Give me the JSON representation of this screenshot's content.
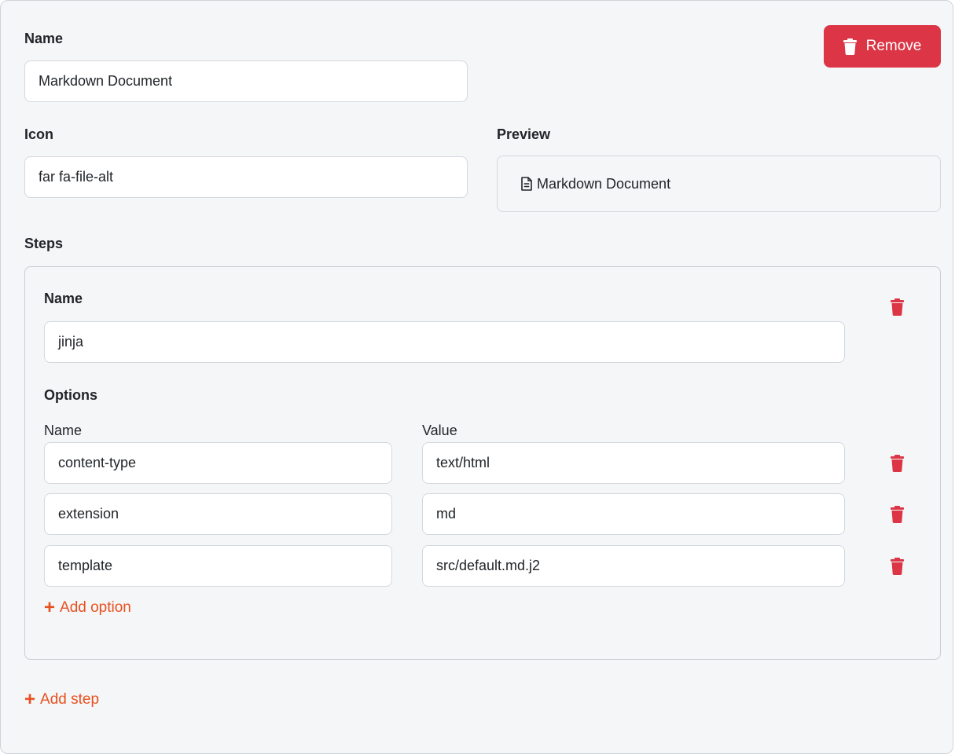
{
  "form": {
    "name_label": "Name",
    "name_value": "Markdown Document",
    "remove_label": "Remove",
    "icon_label": "Icon",
    "icon_value": "far fa-file-alt",
    "preview_label": "Preview",
    "preview_text": "Markdown Document",
    "steps_label": "Steps",
    "add_step_label": "Add step"
  },
  "step": {
    "name_label": "Name",
    "name_value": "jinja",
    "options_label": "Options",
    "col_name_label": "Name",
    "col_value_label": "Value",
    "options": [
      {
        "name": "content-type",
        "value": "text/html"
      },
      {
        "name": "extension",
        "value": "md"
      },
      {
        "name": "template",
        "value": "src/default.md.j2"
      }
    ],
    "add_option_label": "Add option"
  },
  "colors": {
    "danger": "#dc3545",
    "accent": "#e8501f",
    "panel_bg": "#f5f6f8"
  },
  "icons": {
    "remove": "trash-icon",
    "preview": "file-alt-icon",
    "add": "plus-icon"
  }
}
